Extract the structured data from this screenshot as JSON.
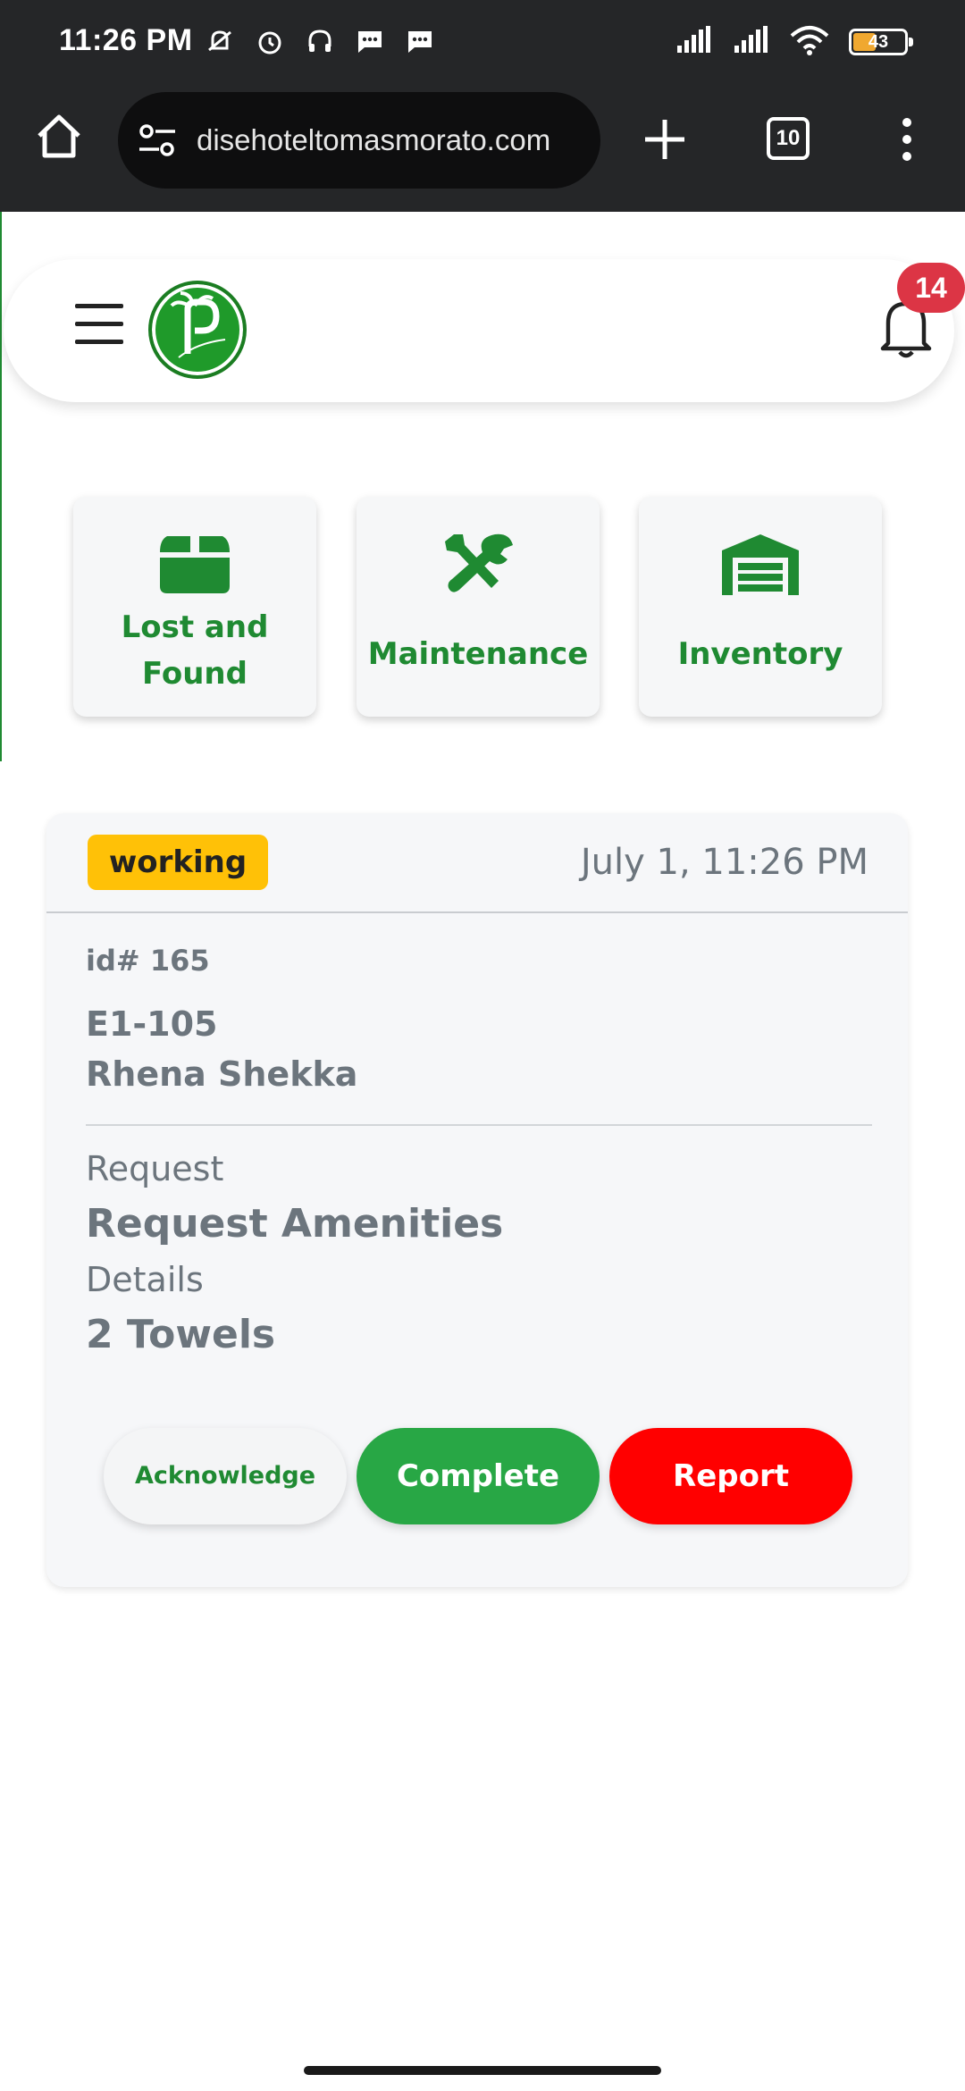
{
  "status_bar": {
    "time": "11:26 PM",
    "battery_level": "43",
    "notification_icons": [
      "muted-bell-icon",
      "alarm-icon",
      "headset-icon",
      "message-icon",
      "message-icon"
    ],
    "system_icons": [
      "signal-icon",
      "signal-icon",
      "wifi-icon",
      "battery-icon"
    ]
  },
  "browser": {
    "url": "disehoteltomasmorato.com",
    "tab_count": "10"
  },
  "header": {
    "notification_count": "14"
  },
  "quick_actions": [
    {
      "label": "Lost and Found",
      "icon": "box-icon"
    },
    {
      "label": "Maintenance",
      "icon": "tools-icon"
    },
    {
      "label": "Inventory",
      "icon": "warehouse-icon"
    }
  ],
  "ticket": {
    "status": "working",
    "date": "July 1, 11:26 PM",
    "id": "id# 165",
    "room": "E1-105",
    "guest": "Rhena Shekka",
    "request_label": "Request",
    "request": "Request Amenities",
    "details_label": "Details",
    "details": "2 Towels",
    "actions": {
      "acknowledge": "Acknowledge",
      "complete": "Complete",
      "report": "Report"
    }
  },
  "colors": {
    "brand_green": "#1f8a32",
    "status_working": "#ffc107",
    "complete": "#28a745",
    "report": "#ff0000",
    "badge": "#dc3545"
  }
}
